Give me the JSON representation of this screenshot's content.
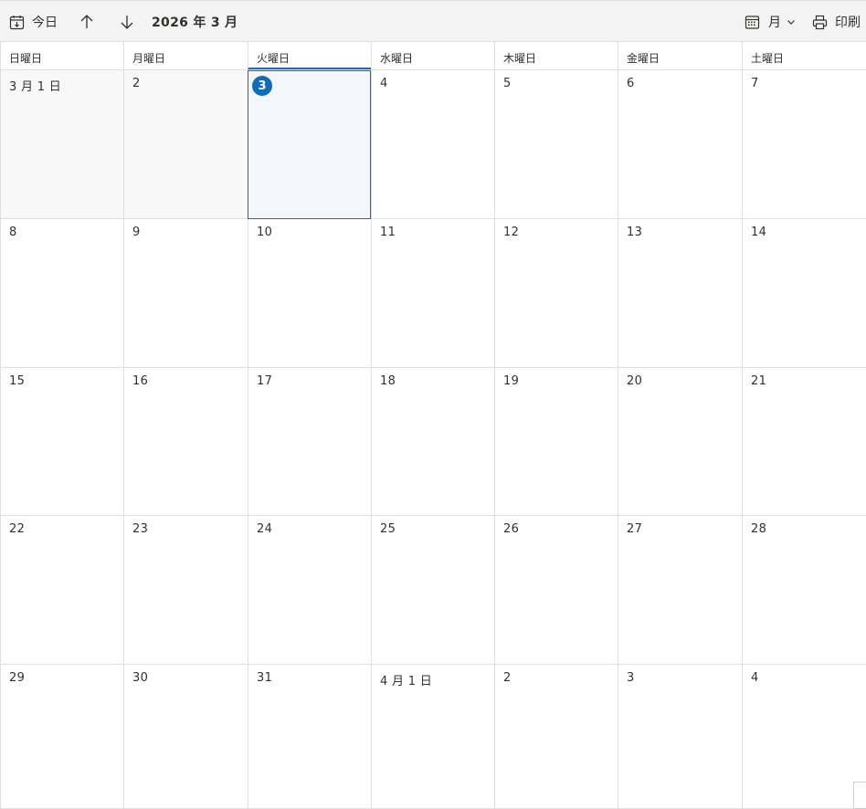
{
  "toolbar": {
    "today_label": "今日",
    "month_title": "2026 年 3 月",
    "view_label": "月",
    "print_label": "印刷",
    "icons": [
      "calendar-today-icon",
      "arrow-up-icon",
      "arrow-down-icon",
      "chevron-down-icon",
      "calendar-icon",
      "printer-icon"
    ]
  },
  "weekdays": [
    "日曜日",
    "月曜日",
    "火曜日",
    "水曜日",
    "木曜日",
    "金曜日",
    "土曜日"
  ],
  "weeks": [
    [
      "3 月 1 日",
      "2",
      "3",
      "4",
      "5",
      "6",
      "7"
    ],
    [
      "8",
      "9",
      "10",
      "11",
      "12",
      "13",
      "14"
    ],
    [
      "15",
      "16",
      "17",
      "18",
      "19",
      "20",
      "21"
    ],
    [
      "22",
      "23",
      "24",
      "25",
      "26",
      "27",
      "28"
    ],
    [
      "29",
      "30",
      "31",
      "4 月 1 日",
      "2",
      "3",
      "4"
    ]
  ],
  "today": {
    "week": 0,
    "day": 2
  },
  "accent_color": "#0f6cbd"
}
